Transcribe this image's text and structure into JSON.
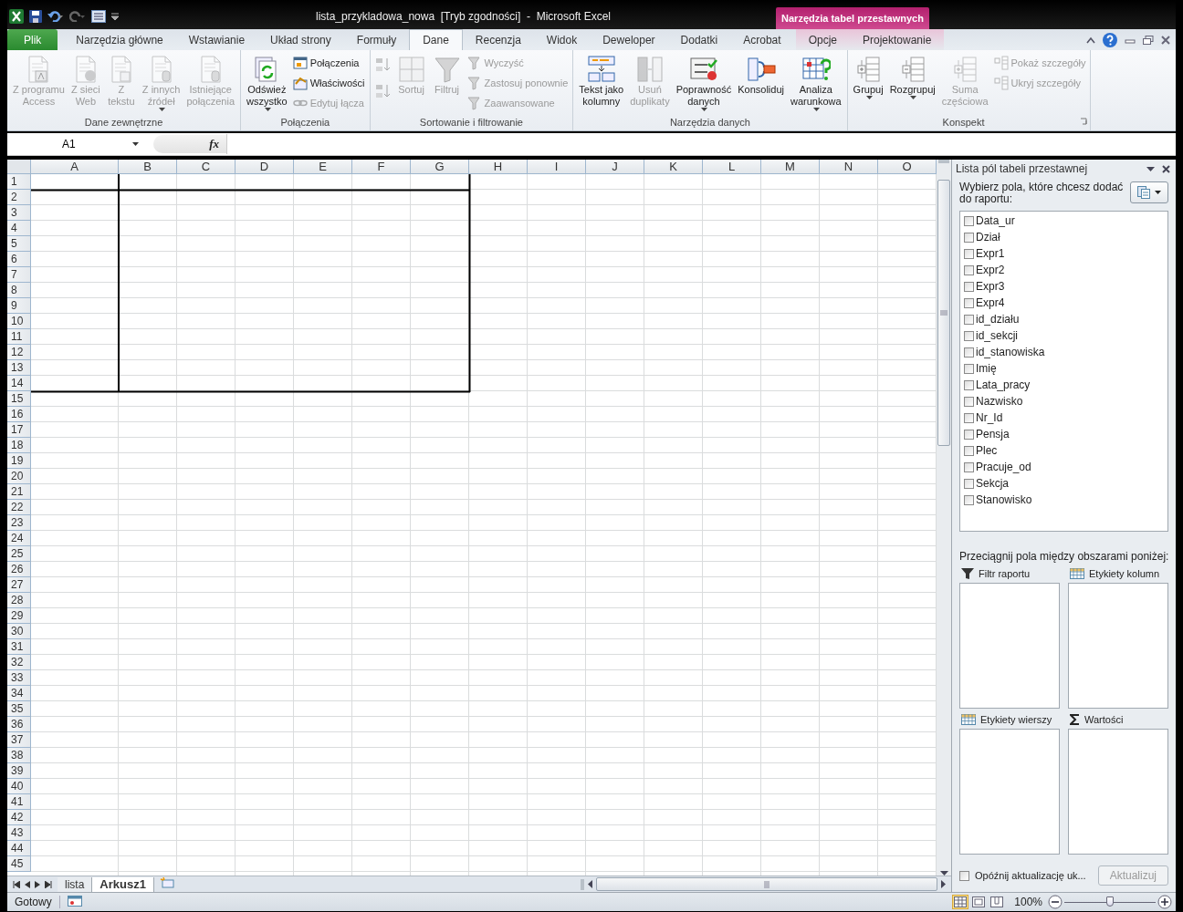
{
  "window": {
    "title": "lista_przykladowa_nowa  [Tryb zgodności]  -  Microsoft Excel",
    "contextual_header": "Narzędzia tabel przestawnych"
  },
  "tabs": [
    {
      "label": "Plik",
      "kind": "file",
      "selected": false
    },
    {
      "label": "Narzędzia główne",
      "kind": "normal",
      "selected": false
    },
    {
      "label": "Wstawianie",
      "kind": "normal",
      "selected": false
    },
    {
      "label": "Układ strony",
      "kind": "normal",
      "selected": false
    },
    {
      "label": "Formuły",
      "kind": "normal",
      "selected": false
    },
    {
      "label": "Dane",
      "kind": "normal",
      "selected": true
    },
    {
      "label": "Recenzja",
      "kind": "normal",
      "selected": false
    },
    {
      "label": "Widok",
      "kind": "normal",
      "selected": false
    },
    {
      "label": "Deweloper",
      "kind": "normal",
      "selected": false
    },
    {
      "label": "Dodatki",
      "kind": "normal",
      "selected": false
    },
    {
      "label": "Acrobat",
      "kind": "normal",
      "selected": false
    },
    {
      "label": "Opcje",
      "kind": "contextual",
      "selected": false
    },
    {
      "label": "Projektowanie",
      "kind": "contextual",
      "selected": false
    }
  ],
  "ribbon": {
    "groups": [
      {
        "label": "Dane zewnętrzne",
        "launcher": false,
        "items": [
          {
            "kind": "large",
            "label": "Z programu\nAccess",
            "disabled": true,
            "dropdown": false
          },
          {
            "kind": "large",
            "label": "Z sieci\nWeb",
            "disabled": true,
            "dropdown": false
          },
          {
            "kind": "large",
            "label": "Z\ntekstu",
            "disabled": true,
            "dropdown": false
          },
          {
            "kind": "large",
            "label": "Z innych\nźródeł",
            "disabled": true,
            "dropdown": true
          },
          {
            "kind": "large",
            "label": "Istniejące\npołączenia",
            "disabled": true,
            "dropdown": false
          }
        ]
      },
      {
        "label": "Połączenia",
        "launcher": false,
        "items": [
          {
            "kind": "large",
            "label": "Odśwież\nwszystko",
            "disabled": false,
            "dropdown": true
          },
          {
            "kind": "small",
            "label": "Połączenia",
            "disabled": false,
            "dropdown": false
          },
          {
            "kind": "small",
            "label": "Właściwości",
            "disabled": false,
            "dropdown": false
          },
          {
            "kind": "small",
            "label": "Edytuj łącza",
            "disabled": true,
            "dropdown": false
          }
        ]
      },
      {
        "label": "Sortowanie i filtrowanie",
        "launcher": false,
        "items": [
          {
            "kind": "icon",
            "disabled": true
          },
          {
            "kind": "icon",
            "disabled": true
          },
          {
            "kind": "large",
            "label": "Sortuj",
            "disabled": true,
            "dropdown": false
          },
          {
            "kind": "large",
            "label": "Filtruj",
            "disabled": true,
            "dropdown": false
          },
          {
            "kind": "small",
            "label": "Wyczyść",
            "disabled": true,
            "dropdown": false
          },
          {
            "kind": "small",
            "label": "Zastosuj ponownie",
            "disabled": true,
            "dropdown": false
          },
          {
            "kind": "small",
            "label": "Zaawansowane",
            "disabled": true,
            "dropdown": false
          }
        ]
      },
      {
        "label": "Narzędzia danych",
        "launcher": false,
        "items": [
          {
            "kind": "large",
            "label": "Tekst jako\nkolumny",
            "disabled": false,
            "dropdown": false
          },
          {
            "kind": "large",
            "label": "Usuń\nduplikaty",
            "disabled": true,
            "dropdown": false
          },
          {
            "kind": "large",
            "label": "Poprawność\ndanych",
            "disabled": false,
            "dropdown": true
          },
          {
            "kind": "large",
            "label": "Konsoliduj",
            "disabled": false,
            "dropdown": false
          },
          {
            "kind": "large",
            "label": "Analiza\nwarunkowa",
            "disabled": false,
            "dropdown": true
          }
        ]
      },
      {
        "label": "Konspekt",
        "launcher": true,
        "items": [
          {
            "kind": "large",
            "label": "Grupuj",
            "disabled": false,
            "dropdown": true
          },
          {
            "kind": "large",
            "label": "Rozgrupuj",
            "disabled": false,
            "dropdown": true
          },
          {
            "kind": "large",
            "label": "Suma\nczęściowa",
            "disabled": true,
            "dropdown": false
          },
          {
            "kind": "small",
            "label": "Pokaż szczegóły",
            "disabled": true,
            "dropdown": false
          },
          {
            "kind": "small",
            "label": "Ukryj szczegóły",
            "disabled": true,
            "dropdown": false
          }
        ]
      }
    ]
  },
  "formula_bar": {
    "name_box": "A1",
    "fx_label": "fx"
  },
  "sheet": {
    "columns": [
      "A",
      "B",
      "C",
      "D",
      "E",
      "F",
      "G",
      "H",
      "I",
      "J",
      "K",
      "L",
      "M",
      "N",
      "O"
    ],
    "rows": [
      "1",
      "2",
      "3",
      "4",
      "5",
      "6",
      "7",
      "8",
      "9",
      "10",
      "11",
      "12",
      "13",
      "14",
      "15",
      "16",
      "17",
      "18",
      "19",
      "20",
      "21",
      "22",
      "23",
      "24",
      "25",
      "26",
      "27",
      "28",
      "29",
      "30",
      "31",
      "32",
      "33",
      "34",
      "35",
      "36",
      "37",
      "38",
      "39",
      "40",
      "41",
      "42",
      "43",
      "44",
      "45"
    ]
  },
  "sheet_tabs": [
    {
      "label": "lista",
      "selected": false
    },
    {
      "label": "Arkusz1",
      "selected": true
    }
  ],
  "pivot_pane": {
    "title": "Lista pól tabeli przestawnej",
    "prompt": "Wybierz pola, które chcesz dodać do raportu:",
    "fields": [
      {
        "label": "Data_ur",
        "checked": false
      },
      {
        "label": "Dział",
        "checked": false
      },
      {
        "label": "Expr1",
        "checked": false
      },
      {
        "label": "Expr2",
        "checked": false
      },
      {
        "label": "Expr3",
        "checked": false
      },
      {
        "label": "Expr4",
        "checked": false
      },
      {
        "label": "id_działu",
        "checked": false
      },
      {
        "label": "id_sekcji",
        "checked": false
      },
      {
        "label": "id_stanowiska",
        "checked": false
      },
      {
        "label": "Imię",
        "checked": false
      },
      {
        "label": "Lata_pracy",
        "checked": false
      },
      {
        "label": "Nazwisko",
        "checked": false
      },
      {
        "label": "Nr_Id",
        "checked": false
      },
      {
        "label": "Pensja",
        "checked": false
      },
      {
        "label": "Plec",
        "checked": false
      },
      {
        "label": "Pracuje_od",
        "checked": false
      },
      {
        "label": "Sekcja",
        "checked": false
      },
      {
        "label": "Stanowisko",
        "checked": false
      }
    ],
    "drag_hint": "Przeciągnij pola między obszarami poniżej:",
    "areas": [
      {
        "kind": "filter",
        "label": "Filtr raportu"
      },
      {
        "kind": "columns",
        "label": "Etykiety kolumn"
      },
      {
        "kind": "rows",
        "label": "Etykiety wierszy"
      },
      {
        "kind": "values",
        "label": "Wartości"
      }
    ],
    "defer": {
      "label": "Opóźnij aktualizację uk...",
      "checked": false
    },
    "update_button": {
      "label": "Aktualizuj",
      "disabled": true
    }
  },
  "status_bar": {
    "text": "Gotowy",
    "views": [
      {
        "kind": "normal",
        "selected": true
      },
      {
        "kind": "layout",
        "selected": false
      },
      {
        "kind": "pagebreak",
        "selected": false
      }
    ],
    "zoom": "100%",
    "zoom_slider": {
      "level": 0.5
    }
  }
}
